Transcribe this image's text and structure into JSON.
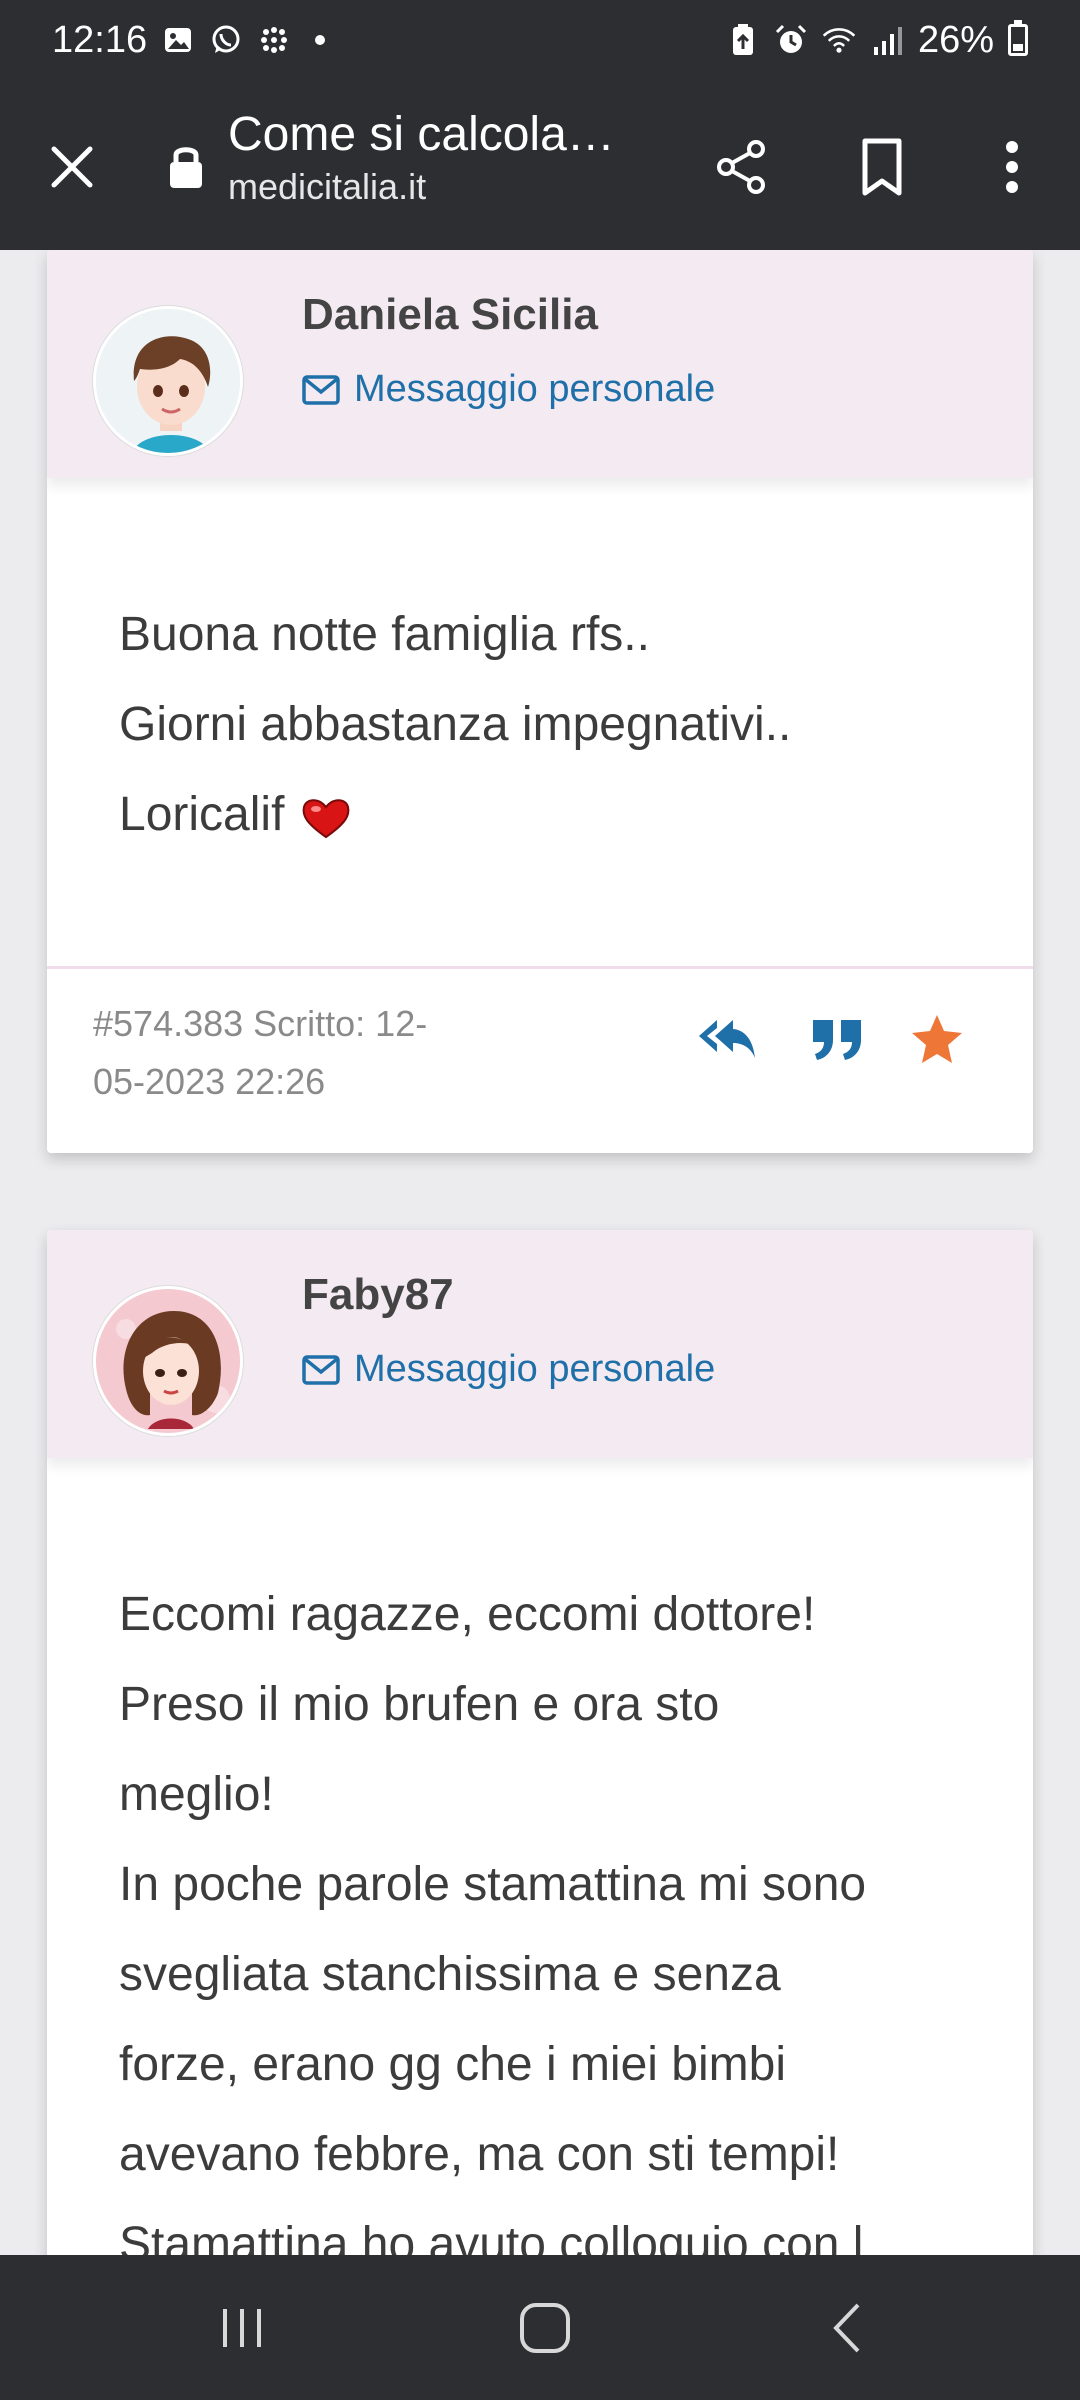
{
  "status_bar": {
    "time": "12:16",
    "battery": "26%"
  },
  "toolbar": {
    "page_title": "Come si calcola…",
    "domain": "medicitalia.it"
  },
  "posts": [
    {
      "author": "Daniela Sicilia",
      "pm_label": "Messaggio personale",
      "lines": [
        "Buona notte famiglia rfs..",
        "Giorni abbastanza impegnativi..",
        "Loricalif"
      ],
      "meta_line1": "#574.383 Scritto: 12-",
      "meta_line2": "05-2023 22:26"
    },
    {
      "author": "Faby87",
      "pm_label": "Messaggio personale",
      "lines": [
        "Eccomi ragazze, eccomi dottore!",
        "Preso il mio brufen e ora sto",
        "meglio!",
        "In poche parole stamattina mi sono",
        "svegliata stanchissima e senza",
        "forze, erano gg che i miei bimbi",
        "avevano febbre, ma con sti tempi!",
        "Stamattina ho avuto colloquio con l"
      ]
    }
  ],
  "colors": {
    "bar_bg": "#2d2e32",
    "header_bg": "#f3ebf1",
    "link": "#1f6fa8",
    "star": "#ee7636"
  },
  "icons": [
    "close-icon",
    "lock-icon",
    "share-icon",
    "bookmark-icon",
    "more-vert-icon",
    "envelope-icon",
    "heart-icon",
    "reply-all-icon",
    "quote-icon",
    "star-icon",
    "recents-icon",
    "home-icon",
    "back-icon"
  ]
}
